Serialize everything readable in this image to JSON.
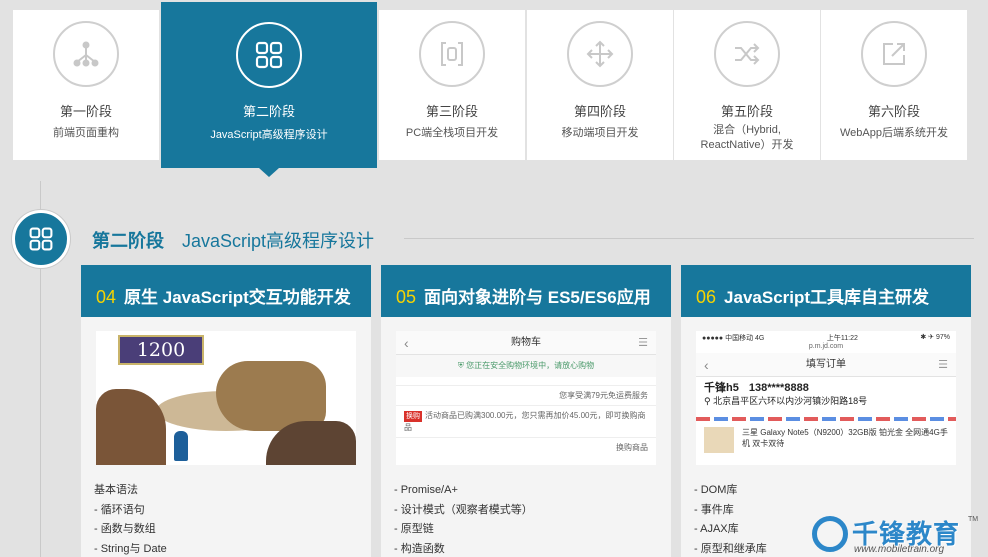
{
  "tabs": [
    {
      "name": "第一阶段",
      "sub": "前端页面重构",
      "icon": "hierarchy-icon"
    },
    {
      "name": "第二阶段",
      "sub": "JavaScript高级程序设计",
      "icon": "grid-icon"
    },
    {
      "name": "第三阶段",
      "sub": "PC端全栈项目开发",
      "icon": "code-bracket-icon"
    },
    {
      "name": "第四阶段",
      "sub": "移动端项目开发",
      "icon": "move-arrows-icon"
    },
    {
      "name": "第五阶段",
      "sub": "混合（Hybrid, ReactNative）开发",
      "icon": "shuffle-icon"
    },
    {
      "name": "第六阶段",
      "sub": "WebApp后端系统开发",
      "icon": "external-link-icon"
    }
  ],
  "active_tab": 1,
  "section": {
    "stage": "第二阶段",
    "title": "JavaScript高级程序设计",
    "icon": "grid-icon"
  },
  "cards": [
    {
      "num": "04",
      "title": "原生 JavaScript交互功能开发",
      "image": {
        "score": "1200"
      },
      "items": [
        "基本语法",
        "- 循环语句",
        "- 函数与数组",
        "- String与 Date"
      ]
    },
    {
      "num": "05",
      "title": "面向对象进阶与 ES5/ES6应用",
      "image": {
        "header": "购物车",
        "safe": "您正在安全购物环境中，请放心购物",
        "ship": "您享受满79元免运费服务",
        "tag": "换购",
        "promo": "活动商品已购满300.00元，您只需再加价45.00元，即可换购商品",
        "link": "换购商品"
      },
      "items": [
        "- Promise/A+",
        "- 设计模式（观察者模式等）",
        "- 原型链",
        "- 构造函数"
      ]
    },
    {
      "num": "06",
      "title": "JavaScript工具库自主研发",
      "image": {
        "carrier": "●●●●● 中国移动  4G",
        "time": "上午11:22",
        "battery": "✱ ✈ 97%",
        "url": "p.m.jd.com",
        "header": "填写订单",
        "name": "千锋h5",
        "phone": "138****8888",
        "address": "北京昌平区六环以内沙河镇沙阳路18号",
        "product": "三星 Galaxy Note5（N9200）32GB版 铂光金 全网通4G手机 双卡双待"
      },
      "items": [
        "- DOM库",
        "- 事件库",
        "- AJAX库",
        "- 原型和继承库"
      ]
    }
  ],
  "watermark": {
    "brand": "千锋教育",
    "url": "www.mobiletrain.org",
    "tm": "TM"
  },
  "colors": {
    "accent": "#17779c",
    "number": "#f6d300",
    "background": "#e2e2e2"
  }
}
